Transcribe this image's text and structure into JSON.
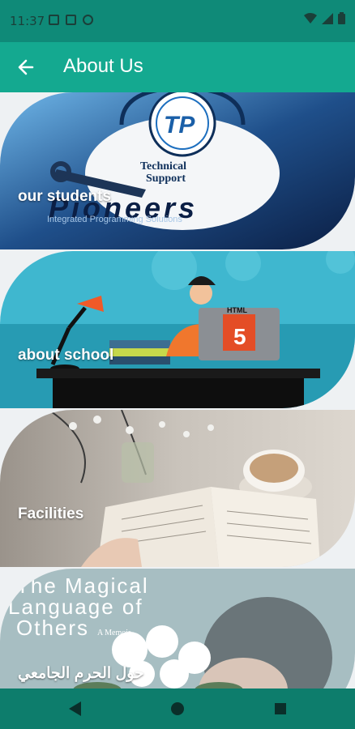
{
  "status_bar": {
    "time": "11:37"
  },
  "app_bar": {
    "title": "About Us"
  },
  "cards": [
    {
      "label": "our students",
      "art": {
        "headline_line1": "Technical",
        "headline_line2": "Support",
        "brand": "Pioneers",
        "brand_sub": "Integrated Programming Solutions",
        "logo": "TP"
      }
    },
    {
      "label": "about school",
      "art": {
        "screen_text": "HTML",
        "screen_badge": "5"
      }
    },
    {
      "label": "Facilities",
      "art": {}
    },
    {
      "label": "حول الحرم الجامعي",
      "art": {
        "book_title_1": "The Magical",
        "book_title_2": "Language of",
        "book_title_3": "Others",
        "book_sub": "A Memoir"
      }
    }
  ],
  "icons": {
    "back": "arrow-left-icon",
    "wifi": "wifi-icon",
    "signal": "signal-icon",
    "battery": "battery-icon",
    "nav_back": "triangle-back-icon",
    "nav_home": "circle-home-icon",
    "nav_recents": "square-recents-icon"
  }
}
